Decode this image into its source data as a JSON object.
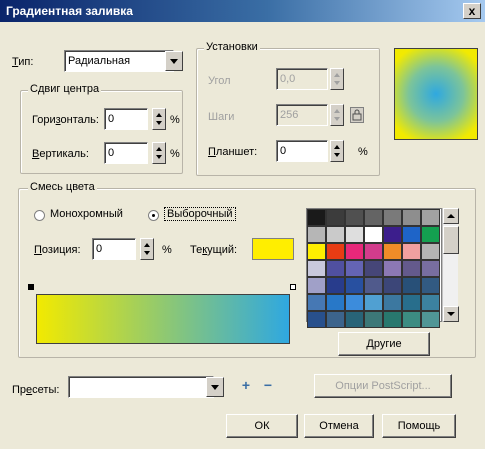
{
  "window": {
    "title": "Градиентная заливка",
    "close_glyph": "x"
  },
  "type_label_pre": "",
  "type_label_u": "Т",
  "type_label_post": "ип:",
  "type_value": "Радиальная",
  "center_offset": {
    "group_label": "Сдвиг центра",
    "horizontal_label_pre": "Гори",
    "horizontal_label_u": "з",
    "horizontal_label_post": "онталь:",
    "horizontal_value": "0",
    "vertical_label_pre": "",
    "vertical_label_u": "В",
    "vertical_label_post": "ертикаль:",
    "vertical_value": "0",
    "percent": "%"
  },
  "settings": {
    "group_label": "Установки",
    "angle_label": "Угол",
    "angle_value": "0,0",
    "steps_label": "Шаги",
    "steps_value": "256",
    "pad_label_pre": "",
    "pad_label_u": "П",
    "pad_label_post": "ланшет:",
    "pad_value": "0",
    "percent": "%"
  },
  "color_blend": {
    "group_label": "Смесь цвета",
    "two_color_label": "Монохромный",
    "custom_label": "Выборочный",
    "position_label_pre": "",
    "position_label_u": "П",
    "position_label_post": "озиция:",
    "position_value": "0",
    "percent": "%",
    "current_label_pre": "Те",
    "current_label_u": "к",
    "current_label_post": "ущий:",
    "current_color": "#ffee00",
    "gradient_start": "#f2ea00",
    "gradient_end": "#2fa8e0"
  },
  "palette": {
    "others_label": "Другие",
    "colors": [
      "#1a1a1a",
      "#3c3c3c",
      "#505050",
      "#646464",
      "#7a7a7a",
      "#8e8e8e",
      "#a2a2a2",
      "#b6b6b6",
      "#cacaca",
      "#dedede",
      "#ffffff",
      "#3c1e8c",
      "#1e64c8",
      "#14a050",
      "#ffee00",
      "#e83c14",
      "#e8287a",
      "#d23c8c",
      "#f08c28",
      "#f0a0a0",
      "#b4b4b4",
      "#c8c8dc",
      "#5050a0",
      "#6464b4",
      "#464678",
      "#8c78b4",
      "#645a8c",
      "#786ea0",
      "#a0a0c8",
      "#283c8c",
      "#2850a0",
      "#505a8c",
      "#3c4678",
      "#285078",
      "#325a82",
      "#4678b4",
      "#2878c8",
      "#3c8cdc",
      "#50a0d2",
      "#3c78a0",
      "#286e8c",
      "#3c82a0",
      "#28508c",
      "#3c648c",
      "#286478",
      "#3c7878",
      "#28786e",
      "#3c8c82",
      "#509696"
    ]
  },
  "presets": {
    "label_pre": "Пр",
    "label_u": "е",
    "label_post": "сеты:",
    "value": "",
    "add_glyph": "+",
    "remove_glyph": "−"
  },
  "buttons": {
    "postscript": "Опции PostScript...",
    "ok": "ОК",
    "cancel": "Отмена",
    "help": "Помощь"
  }
}
